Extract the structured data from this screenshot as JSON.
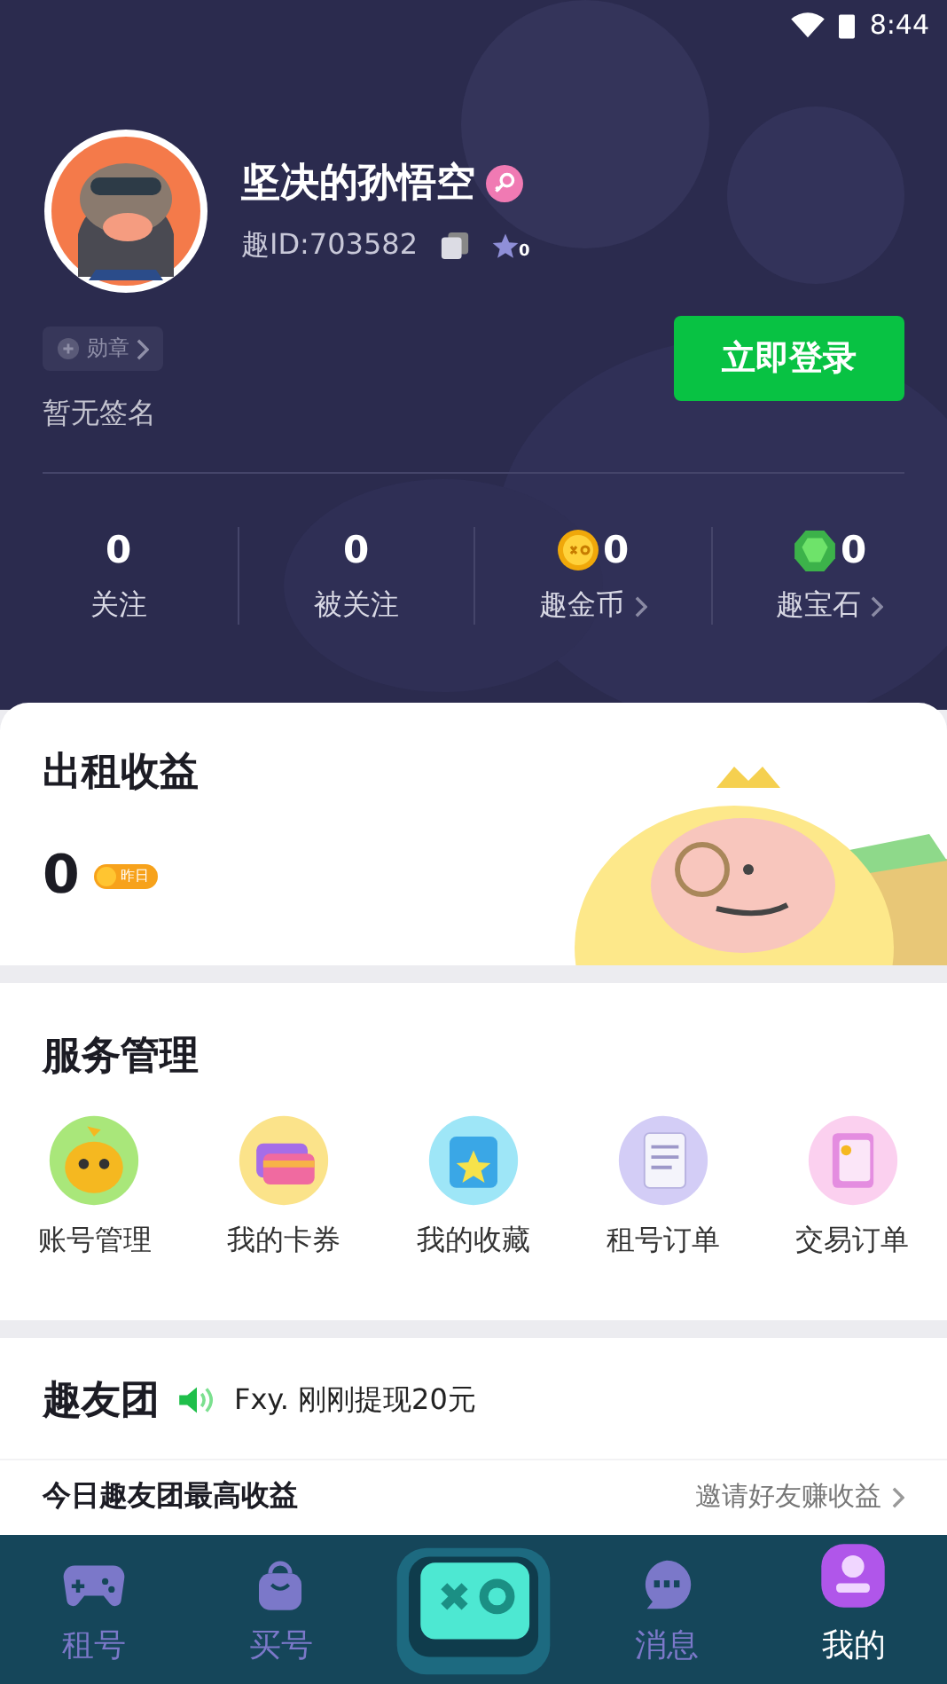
{
  "status_bar": {
    "time": "8:44"
  },
  "profile": {
    "name": "坚决的孙悟空",
    "id_label": "趣ID:703582",
    "star_count": "0",
    "medal_label": "勋章",
    "signature": "暂无签名",
    "login_button": "立即登录"
  },
  "stats": [
    {
      "kind": "plain",
      "value": "0",
      "label": "关注",
      "arrow": false
    },
    {
      "kind": "plain",
      "value": "0",
      "label": "被关注",
      "arrow": false
    },
    {
      "kind": "coin",
      "value": "0",
      "label": "趣金币",
      "arrow": true
    },
    {
      "kind": "gem",
      "value": "0",
      "label": "趣宝石",
      "arrow": true
    }
  ],
  "earnings": {
    "title": "出租收益",
    "value": "0",
    "badge": "昨日"
  },
  "services": {
    "title": "服务管理",
    "items": [
      {
        "kind": "account",
        "label": "账号管理"
      },
      {
        "kind": "cards",
        "label": "我的卡券"
      },
      {
        "kind": "favorites",
        "label": "我的收藏"
      },
      {
        "kind": "rent_orders",
        "label": "租号订单"
      },
      {
        "kind": "trade_orders",
        "label": "交易订单"
      }
    ]
  },
  "club": {
    "title": "趣友团",
    "notice": "Fxy. 刚刚提现20元",
    "highlight_label": "今日趣友团最高收益",
    "invite_link": "邀请好友赚收益"
  },
  "tab_bar": [
    {
      "kind": "gamepad",
      "label": "租号",
      "selected": false
    },
    {
      "kind": "bag",
      "label": "买号",
      "selected": false
    },
    {
      "kind": "center",
      "selected": false
    },
    {
      "kind": "chat",
      "label": "消息",
      "selected": false
    },
    {
      "kind": "user",
      "label": "我的",
      "selected": true
    }
  ]
}
